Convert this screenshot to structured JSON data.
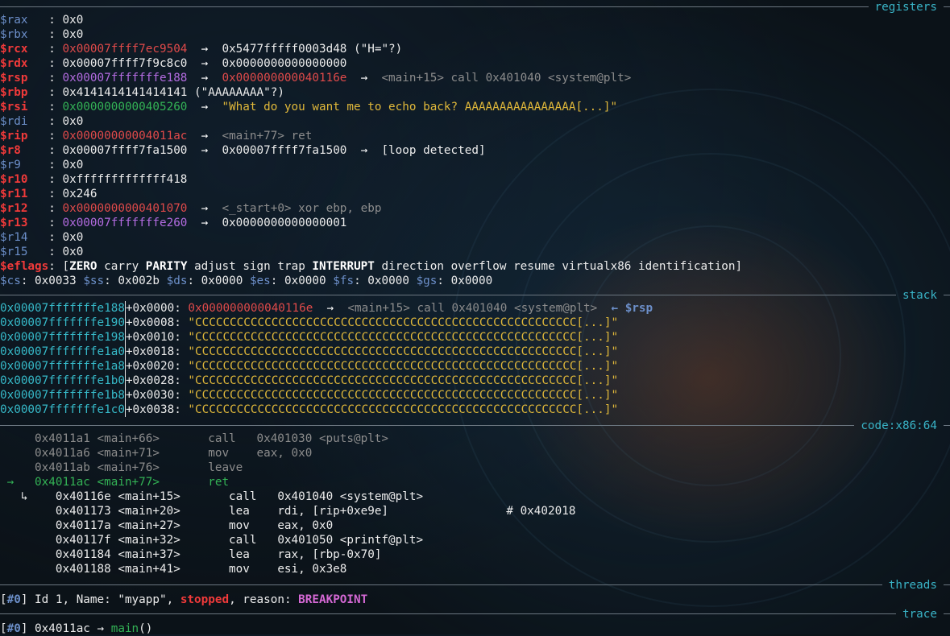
{
  "sections": {
    "registers": "registers",
    "stack": "stack",
    "code": "code:x86:64",
    "threads": "threads",
    "trace": "trace"
  },
  "registers": [
    {
      "name": "$rax",
      "sep": "   : ",
      "val": "0x0",
      "style": "plain"
    },
    {
      "name": "$rbx",
      "sep": "   : ",
      "val": "0x0",
      "style": "plain"
    },
    {
      "name": "$rcx",
      "sep": "   : ",
      "val": "0x00007ffff7ec9504",
      "style": "changed",
      "deref": "0x5477fffff0003d48 (\"H=\"?)"
    },
    {
      "name": "$rdx",
      "sep": "   : ",
      "val": "0x00007ffff7f9c8c0",
      "style": "changed-plain",
      "deref": "0x0000000000000000"
    },
    {
      "name": "$rsp",
      "sep": "   : ",
      "val": "0x00007fffffffe188",
      "style": "stackptr",
      "deref": "0x000000000040116e",
      "deref2": "<main+15> call 0x401040 <system@plt>"
    },
    {
      "name": "$rbp",
      "sep": "   : ",
      "val": "0x4141414141414141 (\"AAAAAAAA\"?)",
      "style": "changed-plain"
    },
    {
      "name": "$rsi",
      "sep": "   : ",
      "val": "0x0000000000405260",
      "style": "heap",
      "deref": "\"What do you want me to echo back? AAAAAAAAAAAAAAAA[...]\""
    },
    {
      "name": "$rdi",
      "sep": "   : ",
      "val": "0x0",
      "style": "plain"
    },
    {
      "name": "$rip",
      "sep": "   : ",
      "val": "0x00000000004011ac",
      "style": "code",
      "deref": "<main+77> ret"
    },
    {
      "name": "$r8",
      "sep": "    : ",
      "val": "0x00007ffff7fa1500",
      "style": "changed-plain",
      "deref": "0x00007ffff7fa1500",
      "deref2": "[loop detected]"
    },
    {
      "name": "$r9",
      "sep": "    : ",
      "val": "0x0",
      "style": "plain"
    },
    {
      "name": "$r10",
      "sep": "   : ",
      "val": "0xfffffffffffff418",
      "style": "changed-plain"
    },
    {
      "name": "$r11",
      "sep": "   : ",
      "val": "0x246",
      "style": "changed-plain"
    },
    {
      "name": "$r12",
      "sep": "   : ",
      "val": "0x0000000000401070",
      "style": "code",
      "deref": "<_start+0> xor ebp, ebp"
    },
    {
      "name": "$r13",
      "sep": "   : ",
      "val": "0x00007fffffffe260",
      "style": "stackptr-plain",
      "deref": "0x0000000000000001"
    },
    {
      "name": "$r14",
      "sep": "   : ",
      "val": "0x0",
      "style": "plain"
    },
    {
      "name": "$r15",
      "sep": "   : ",
      "val": "0x0",
      "style": "plain"
    }
  ],
  "eflags": {
    "name": "$eflags",
    "open": ": [",
    "flags": [
      {
        "text": "ZERO",
        "on": true
      },
      {
        "text": "carry",
        "on": false
      },
      {
        "text": "PARITY",
        "on": true
      },
      {
        "text": "adjust",
        "on": false
      },
      {
        "text": "sign",
        "on": false
      },
      {
        "text": "trap",
        "on": false
      },
      {
        "text": "INTERRUPT",
        "on": true
      },
      {
        "text": "direction",
        "on": false
      },
      {
        "text": "overflow",
        "on": false
      },
      {
        "text": "resume",
        "on": false
      },
      {
        "text": "virtualx86",
        "on": false
      },
      {
        "text": "identification",
        "on": false
      }
    ],
    "close": "]"
  },
  "segments": [
    {
      "name": "$cs",
      "val": "0x0033"
    },
    {
      "name": "$ss",
      "val": "0x002b"
    },
    {
      "name": "$ds",
      "val": "0x0000"
    },
    {
      "name": "$es",
      "val": "0x0000"
    },
    {
      "name": "$fs",
      "val": "0x0000"
    },
    {
      "name": "$gs",
      "val": "0x0000"
    }
  ],
  "stack": [
    {
      "addr": "0x00007fffffffe188",
      "off": "+0x0000: ",
      "val": "0x000000000040116e",
      "arrow": "→",
      "sym": "<main+15> call 0x401040 <system@plt>",
      "tag": "← $rsp"
    },
    {
      "addr": "0x00007fffffffe190",
      "off": "+0x0008: ",
      "str": "\"CCCCCCCCCCCCCCCCCCCCCCCCCCCCCCCCCCCCCCCCCCCCCCCCCCCCCCC[...]\""
    },
    {
      "addr": "0x00007fffffffe198",
      "off": "+0x0010: ",
      "str": "\"CCCCCCCCCCCCCCCCCCCCCCCCCCCCCCCCCCCCCCCCCCCCCCCCCCCCCCC[...]\""
    },
    {
      "addr": "0x00007fffffffe1a0",
      "off": "+0x0018: ",
      "str": "\"CCCCCCCCCCCCCCCCCCCCCCCCCCCCCCCCCCCCCCCCCCCCCCCCCCCCCCC[...]\""
    },
    {
      "addr": "0x00007fffffffe1a8",
      "off": "+0x0020: ",
      "str": "\"CCCCCCCCCCCCCCCCCCCCCCCCCCCCCCCCCCCCCCCCCCCCCCCCCCCCCCC[...]\""
    },
    {
      "addr": "0x00007fffffffe1b0",
      "off": "+0x0028: ",
      "str": "\"CCCCCCCCCCCCCCCCCCCCCCCCCCCCCCCCCCCCCCCCCCCCCCCCCCCCCCC[...]\""
    },
    {
      "addr": "0x00007fffffffe1b8",
      "off": "+0x0030: ",
      "str": "\"CCCCCCCCCCCCCCCCCCCCCCCCCCCCCCCCCCCCCCCCCCCCCCCCCCCCCCC[...]\""
    },
    {
      "addr": "0x00007fffffffe1c0",
      "off": "+0x0038: ",
      "str": "\"CCCCCCCCCCCCCCCCCCCCCCCCCCCCCCCCCCCCCCCCCCCCCCCCCCCCCCC[...]\""
    }
  ],
  "code_before": [
    {
      "addr": "0x4011a1",
      "sym": "<main+66>",
      "mn": "call",
      "op": "0x401030 <puts@plt>"
    },
    {
      "addr": "0x4011a6",
      "sym": "<main+71>",
      "mn": "mov",
      "op": "eax, 0x0"
    },
    {
      "addr": "0x4011ab",
      "sym": "<main+76>",
      "mn": "leave",
      "op": ""
    }
  ],
  "code_current": {
    "marker": "→",
    "addr": "0x4011ac",
    "sym": "<main+77>",
    "mn": "ret",
    "op": ""
  },
  "code_after": [
    {
      "marker": "↳",
      "addr": "0x40116e",
      "sym": "<main+15>",
      "mn": "call",
      "op": "0x401040 <system@plt>",
      "comment": ""
    },
    {
      "marker": "",
      "addr": "0x401173",
      "sym": "<main+20>",
      "mn": "lea",
      "op": "rdi, [rip+0xe9e]",
      "comment": "# 0x402018"
    },
    {
      "marker": "",
      "addr": "0x40117a",
      "sym": "<main+27>",
      "mn": "mov",
      "op": "eax, 0x0",
      "comment": ""
    },
    {
      "marker": "",
      "addr": "0x40117f",
      "sym": "<main+32>",
      "mn": "call",
      "op": "0x401050 <printf@plt>",
      "comment": ""
    },
    {
      "marker": "",
      "addr": "0x401184",
      "sym": "<main+37>",
      "mn": "lea",
      "op": "rax, [rbp-0x70]",
      "comment": ""
    },
    {
      "marker": "",
      "addr": "0x401188",
      "sym": "<main+41>",
      "mn": "mov",
      "op": "esi, 0x3e8",
      "comment": ""
    }
  ],
  "threads": {
    "idx": "[#0]",
    "text": " Id 1, Name: \"myapp\", ",
    "state": "stopped",
    "mid": ", reason: ",
    "reason": "BREAKPOINT"
  },
  "trace": {
    "idx": "[#0]",
    "addr": " 0x4011ac",
    "arrow": " → ",
    "func": "main",
    "tail": "()"
  }
}
